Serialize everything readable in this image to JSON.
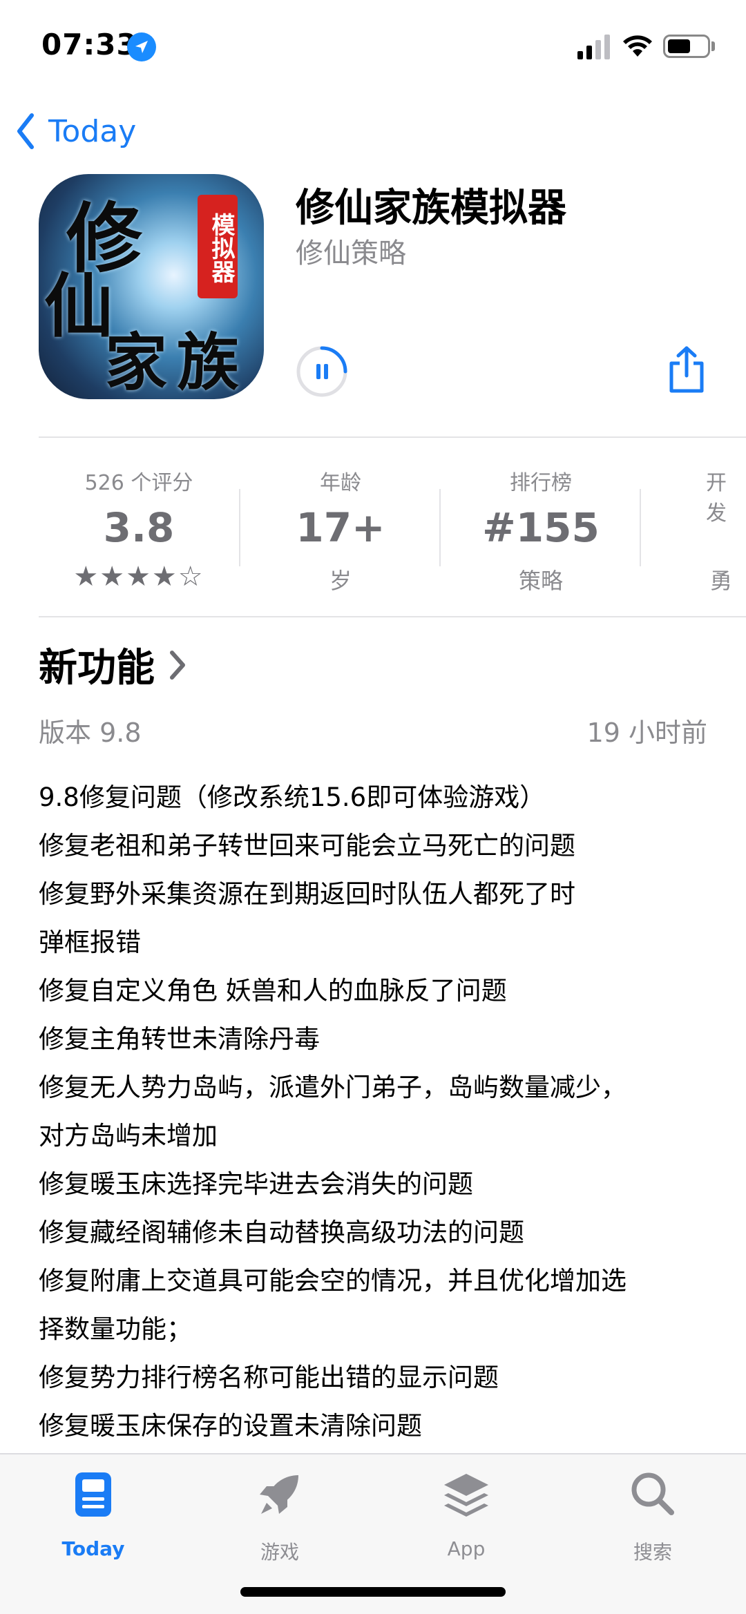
{
  "status_bar": {
    "time": "07:33"
  },
  "nav": {
    "back_label": "Today"
  },
  "app": {
    "title": "修仙家族模拟器",
    "subtitle": "修仙策略",
    "icon_glyphs": [
      "修",
      "仙",
      "家",
      "族"
    ],
    "icon_seal": "模拟器"
  },
  "info": {
    "ratings": {
      "label": "526 个评分",
      "value": "3.8",
      "stars": "★★★★☆"
    },
    "age": {
      "label": "年龄",
      "value": "17+",
      "sub": "岁"
    },
    "chart": {
      "label": "排行榜",
      "value": "#155",
      "sub": "策略"
    },
    "developer": {
      "label": "开发",
      "sub": "勇"
    }
  },
  "whats_new": {
    "title": "新功能",
    "version": "版本 9.8",
    "time_ago": "19 小时前",
    "notes": [
      "9.8修复问题（修改系统15.6即可体验游戏）",
      "修复老祖和弟子转世回来可能会立马死亡的问题",
      "修复野外采集资源在到期返回时队伍人都死了时",
      "弹框报错",
      "修复自定义角色 妖兽和人的血脉反了问题",
      "修复主角转世未清除丹毒",
      "修复无人势力岛屿，派遣外门弟子，岛屿数量减少，",
      "对方岛屿未增加",
      "修复暖玉床选择完毕进去会消失的问题",
      "修复藏经阁辅修未自动替换高级功法的问题",
      "修复附庸上交道具可能会空的情况，并且优化增加选",
      "择数量功能；",
      "修复势力排行榜名称可能出错的显示问题",
      "修复暖玉床保存的设置未清除问题"
    ]
  },
  "tabs": [
    {
      "label": "Today",
      "icon": "today-icon",
      "active": true
    },
    {
      "label": "游戏",
      "icon": "rocket-icon",
      "active": false
    },
    {
      "label": "App",
      "icon": "layers-icon",
      "active": false
    },
    {
      "label": "搜索",
      "icon": "search-icon",
      "active": false
    }
  ],
  "colors": {
    "accent": "#1a7cf5",
    "secondary_text": "#8a8a8e"
  }
}
